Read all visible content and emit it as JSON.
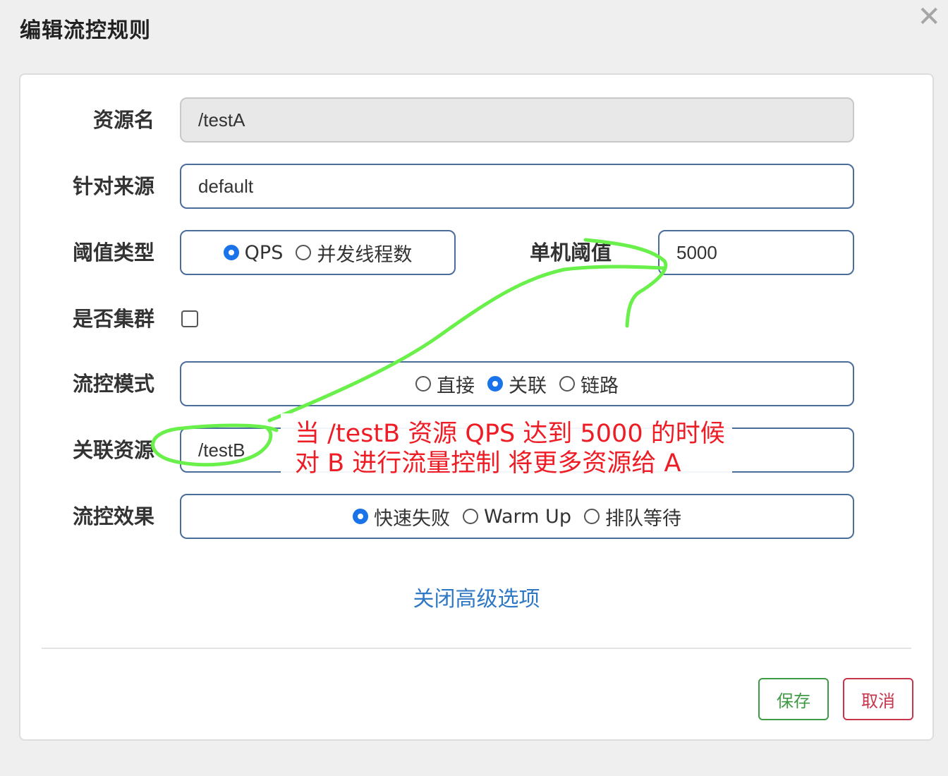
{
  "dialog": {
    "title": "编辑流控规则",
    "close_icon": "close-icon"
  },
  "form": {
    "resource_name": {
      "label": "资源名",
      "value": "/testA"
    },
    "limit_app": {
      "label": "针对来源",
      "value": "default"
    },
    "threshold_type": {
      "label": "阈值类型",
      "options": [
        "QPS",
        "并发线程数"
      ],
      "selected": "QPS"
    },
    "threshold": {
      "label": "单机阈值",
      "value": "5000"
    },
    "cluster": {
      "label": "是否集群",
      "checked": false
    },
    "strategy": {
      "label": "流控模式",
      "options": [
        "直接",
        "关联",
        "链路"
      ],
      "selected": "关联"
    },
    "ref_resource": {
      "label": "关联资源",
      "value": "/testB"
    },
    "control_behavior": {
      "label": "流控效果",
      "options": [
        "快速失败",
        "Warm Up",
        "排队等待"
      ],
      "selected": "快速失败"
    },
    "advanced_link": "关闭高级选项"
  },
  "buttons": {
    "save": "保存",
    "cancel": "取消"
  },
  "annotation": {
    "line1": "当 /testB 资源 QPS 达到 5000 的时候",
    "line2": "对 B 进行流量控制   将更多资源给 A",
    "color": "#ee1c25",
    "stroke_color": "#6af04a"
  },
  "colors": {
    "border_blue": "#4a6d9c",
    "radio_blue": "#1a73e8",
    "link_blue": "#2e78c4",
    "save_green": "#3e9a44",
    "cancel_red": "#c7354a"
  }
}
